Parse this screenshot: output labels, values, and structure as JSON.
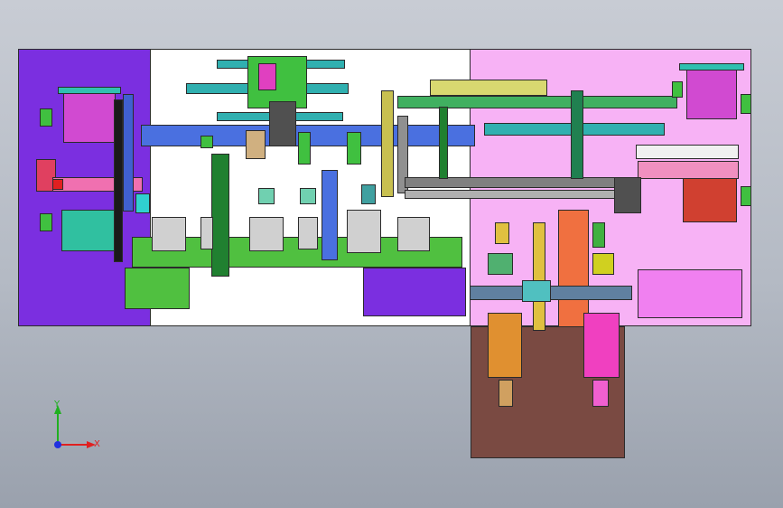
{
  "view": {
    "background_top": "#c8ccd4",
    "background_bottom": "#9aa1ad"
  },
  "zones": {
    "left_zone_color": "#7b2fe0",
    "center_zone_color": "#ffffff",
    "right_zone_color": "#f7b2f5",
    "lower_zone_color": "#7a4a42"
  },
  "triad": {
    "axis_x_label": "X",
    "axis_y_label": "Y",
    "x_color": "#e02020",
    "y_color": "#20b020",
    "z_color": "#2030e0"
  }
}
